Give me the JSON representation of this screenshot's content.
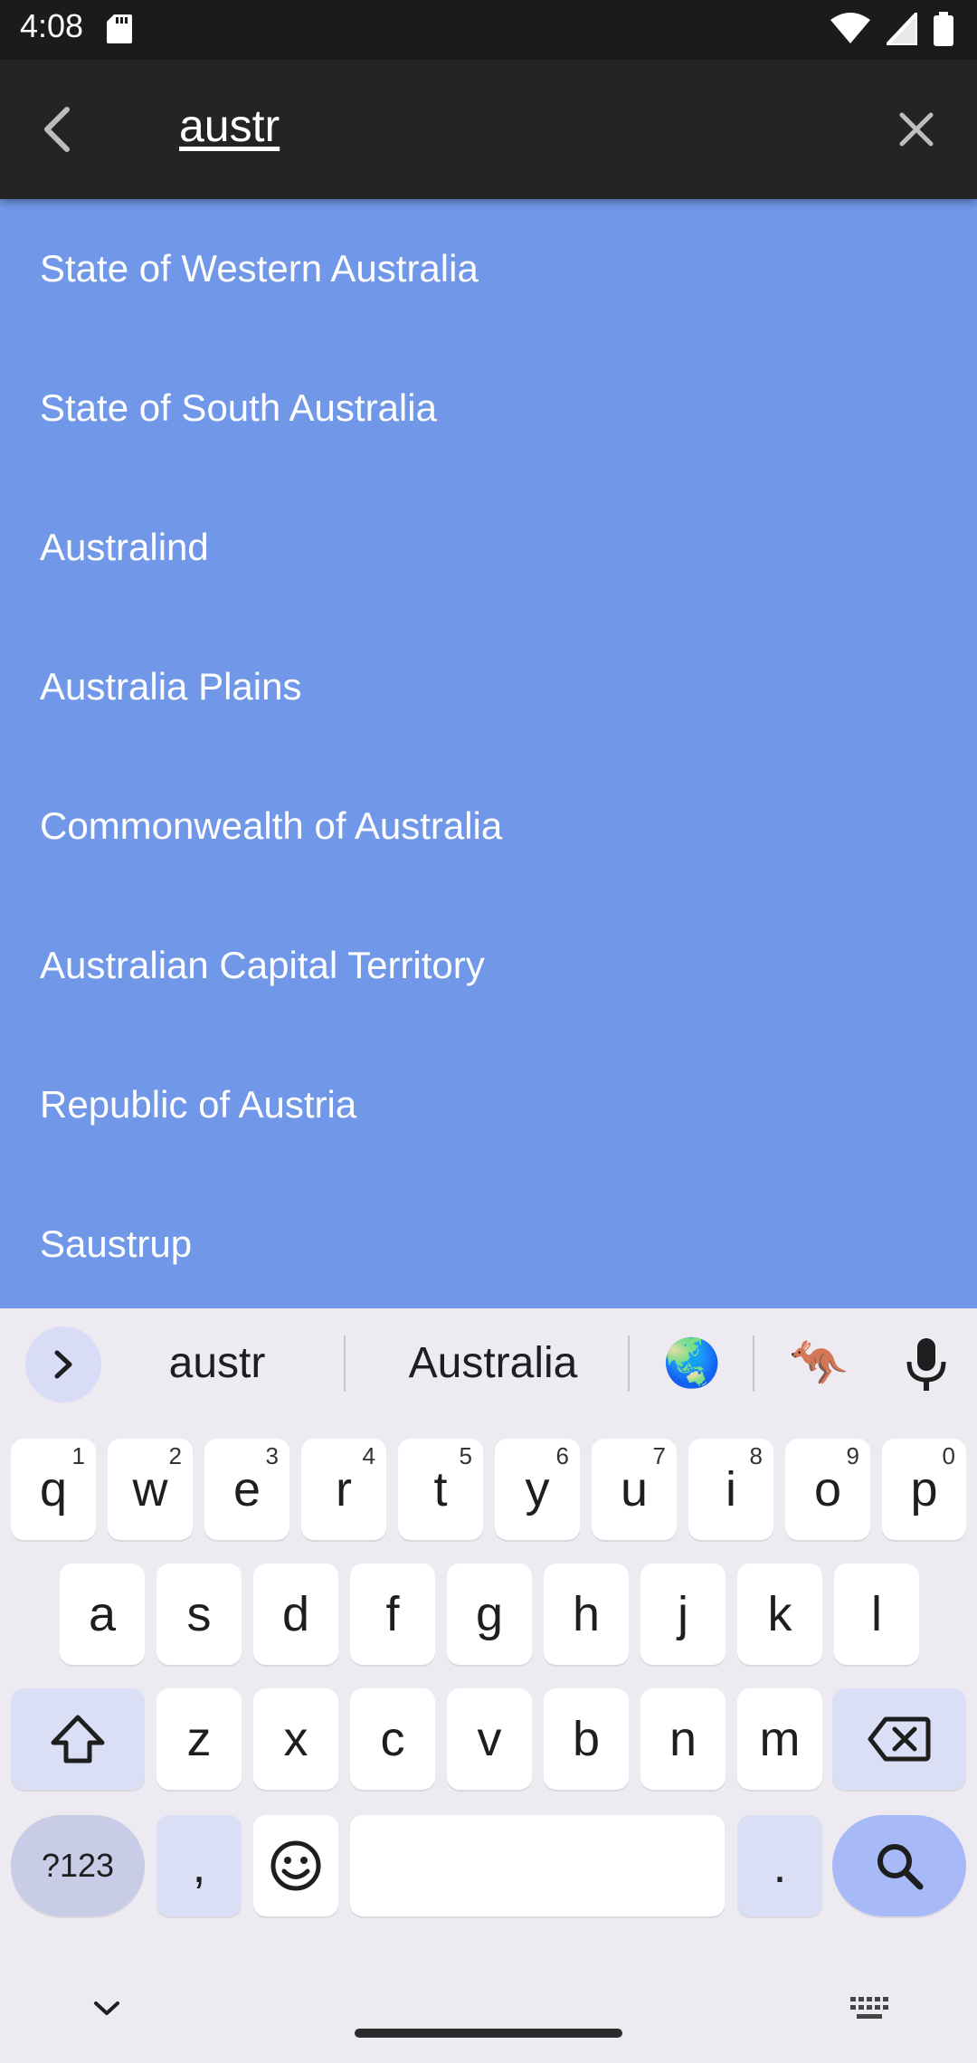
{
  "status_bar": {
    "time": "4:08",
    "icons": [
      "sd-card-icon",
      "wifi-icon",
      "signal-icon",
      "battery-icon"
    ]
  },
  "search_bar": {
    "query": "austr",
    "back_icon": "back-arrow-icon",
    "clear_icon": "close-icon"
  },
  "results": [
    {
      "label": "State of Western Australia"
    },
    {
      "label": "State of South Australia"
    },
    {
      "label": "Australind"
    },
    {
      "label": "Australia Plains"
    },
    {
      "label": "Commonwealth of Australia"
    },
    {
      "label": "Australian Capital Territory"
    },
    {
      "label": "Republic of Austria"
    },
    {
      "label": "Saustrup"
    }
  ],
  "keyboard": {
    "suggestions": [
      "austr",
      "Australia",
      "🌏",
      "🦘"
    ],
    "row1": [
      {
        "k": "q",
        "n": "1"
      },
      {
        "k": "w",
        "n": "2"
      },
      {
        "k": "e",
        "n": "3"
      },
      {
        "k": "r",
        "n": "4"
      },
      {
        "k": "t",
        "n": "5"
      },
      {
        "k": "y",
        "n": "6"
      },
      {
        "k": "u",
        "n": "7"
      },
      {
        "k": "i",
        "n": "8"
      },
      {
        "k": "o",
        "n": "9"
      },
      {
        "k": "p",
        "n": "0"
      }
    ],
    "row2": [
      "a",
      "s",
      "d",
      "f",
      "g",
      "h",
      "j",
      "k",
      "l"
    ],
    "row3": [
      "z",
      "x",
      "c",
      "v",
      "b",
      "n",
      "m"
    ],
    "symbols_label": "?123",
    "comma": ",",
    "period": "."
  },
  "colors": {
    "results_bg": "#7097e8",
    "app_bar_bg": "#242424",
    "status_bar_bg": "#1b1b1b",
    "keyboard_bg": "#eeeaf2",
    "search_key_bg": "#a7b9f6",
    "modifier_key_bg": "#dbdff6"
  }
}
